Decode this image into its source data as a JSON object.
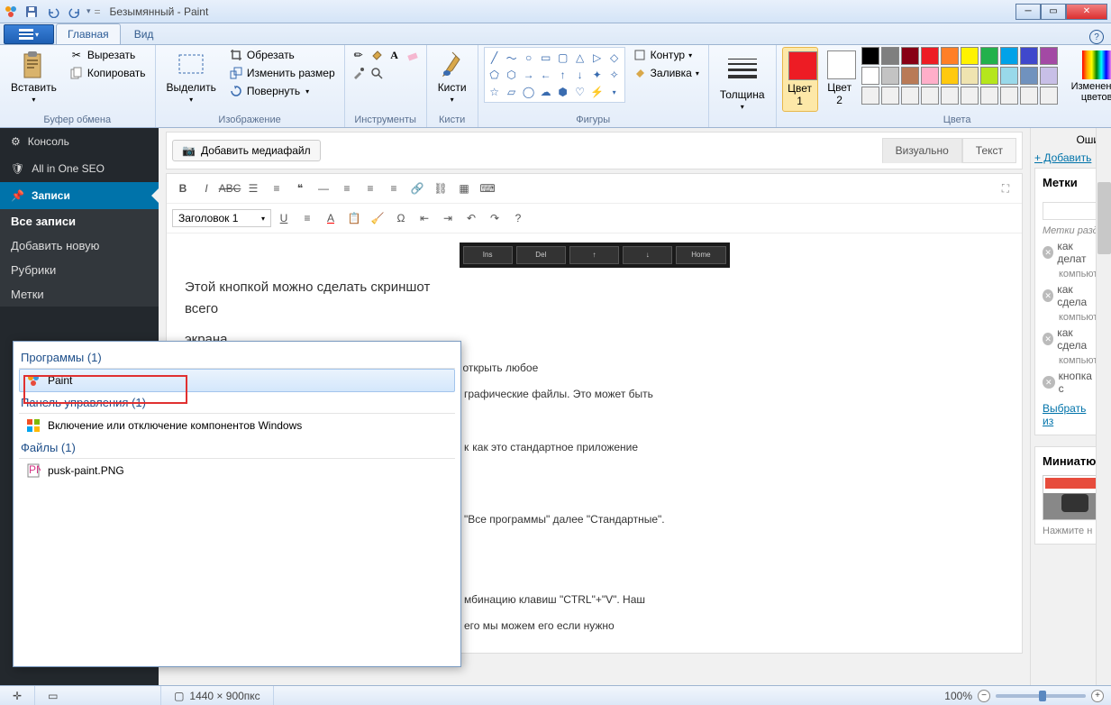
{
  "title": "Безымянный - Paint",
  "tabs": {
    "main": "Главная",
    "view": "Вид"
  },
  "clipboard": {
    "paste": "Вставить",
    "cut": "Вырезать",
    "copy": "Копировать",
    "label": "Буфер обмена"
  },
  "image": {
    "select": "Выделить",
    "crop": "Обрезать",
    "resize": "Изменить размер",
    "rotate": "Повернуть",
    "label": "Изображение"
  },
  "tools": {
    "label": "Инструменты"
  },
  "brushes": {
    "label": "Кисти"
  },
  "shapes": {
    "outline": "Контур",
    "fill": "Заливка",
    "label": "Фигуры"
  },
  "thickness": {
    "label": "Толщина"
  },
  "colors": {
    "c1": "Цвет 1",
    "c2": "Цвет 2",
    "edit": "Изменение цветов",
    "label": "Цвета"
  },
  "palette_row1": [
    "#000000",
    "#7f7f7f",
    "#880015",
    "#ed1c24",
    "#ff7f27",
    "#fff200",
    "#22b14c",
    "#00a2e8",
    "#3f48cc",
    "#a349a4"
  ],
  "palette_row2": [
    "#ffffff",
    "#c3c3c3",
    "#b97a57",
    "#ffaec9",
    "#ffc90e",
    "#efe4b0",
    "#b5e61d",
    "#99d9ea",
    "#7092be",
    "#c8bfe7"
  ],
  "palette_row3": [
    "#f0f0f0",
    "#f0f0f0",
    "#f0f0f0",
    "#f0f0f0",
    "#f0f0f0",
    "#f0f0f0",
    "#f0f0f0",
    "#f0f0f0",
    "#f0f0f0",
    "#f0f0f0"
  ],
  "wp": {
    "sidebar": {
      "console": "Консоль",
      "seo": "All in One SEO",
      "posts": "Записи",
      "all_posts": "Все записи",
      "add_new": "Добавить новую",
      "categories": "Рубрики",
      "tags": "Метки"
    },
    "media_btn": "Добавить медиафайл",
    "tabs": {
      "visual": "Визуально",
      "text": "Текст"
    },
    "heading": "Заголовок 1",
    "content": {
      "caption1": "Этой кнопкой можно сделать скриншот всего",
      "caption2": "экрана",
      "p1": "Но чтобы его увидеть и сохранить в файл необходимо открыть любое",
      "p2_frag": "графические файлы. Это может быть",
      "p3_frag": "как это стандартное приложение",
      "p4_frag": "\"Все программы\" далее \"Стандартные\".",
      "p5_frag": "мбинацию клавиш \"CTRL\"+\"V\". Наш",
      "p6_frag": "его мы можем его если нужно"
    },
    "right": {
      "errors": "Ошиб",
      "add": "+ Добавить",
      "tags_h": "Метки",
      "tags_hint": "Метки разд",
      "tag1": "как делат",
      "tag_sub": "компьюте",
      "tag2": "как сдела",
      "tag3": "как сдела",
      "tag4": "кнопка с",
      "choose": "Выбрать из",
      "thumb_h": "Миниатюр",
      "thumb_hint": "Нажмите н"
    }
  },
  "start": {
    "programs": "Программы (1)",
    "paint": "Paint",
    "control": "Панель управления (1)",
    "components": "Включение или отключение компонентов Windows",
    "files": "Файлы (1)",
    "file1": "pusk-paint.PNG"
  },
  "status": {
    "dims": "1440 × 900пкс",
    "zoom": "100%"
  }
}
